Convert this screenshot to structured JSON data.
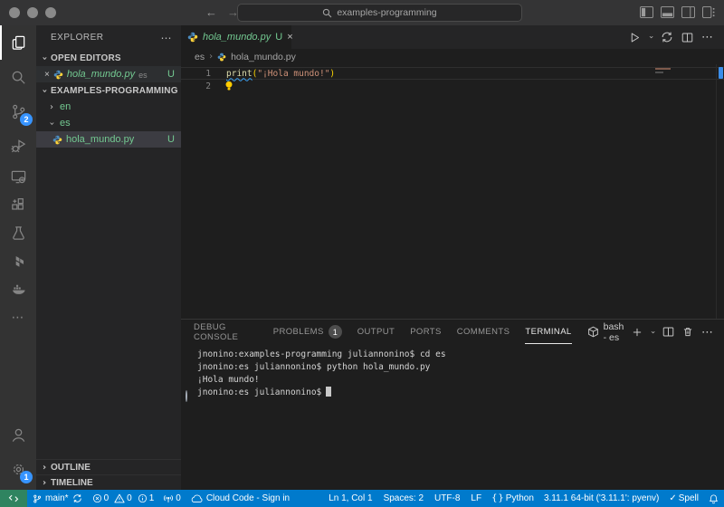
{
  "titlebar": {
    "search_text": "examples-programming"
  },
  "activity_bar": {
    "scm_badge": "2",
    "settings_badge": "1"
  },
  "sidebar": {
    "title": "EXPLORER",
    "open_editors_label": "OPEN EDITORS",
    "open_editor": {
      "file": "hola_mundo.py",
      "path": "es",
      "git": "U"
    },
    "workspace_label": "EXAMPLES-PROGRAMMING",
    "tree": [
      {
        "label": "en"
      },
      {
        "label": "es"
      },
      {
        "label": "hola_mundo.py",
        "git": "U"
      }
    ],
    "outline_label": "OUTLINE",
    "timeline_label": "TIMELINE"
  },
  "editor": {
    "tab": {
      "file": "hola_mundo.py",
      "git": "U"
    },
    "breadcrumb": {
      "folder": "es",
      "file": "hola_mundo.py"
    },
    "code": {
      "line1_num": "1",
      "line2_num": "2",
      "fn": "print",
      "paren_open": "(",
      "string": "\"¡Hola mundo!\"",
      "paren_close": ")"
    }
  },
  "panel": {
    "tabs": [
      {
        "label": "DEBUG CONSOLE"
      },
      {
        "label": "PROBLEMS",
        "badge": "1"
      },
      {
        "label": "OUTPUT"
      },
      {
        "label": "PORTS"
      },
      {
        "label": "COMMENTS"
      },
      {
        "label": "TERMINAL"
      }
    ],
    "shell_label": "bash - es",
    "terminal_lines": [
      {
        "text": "jnonino:examples-programming juliannonino$ cd es"
      },
      {
        "text": "jnonino:es juliannonino$ python hola_mundo.py"
      },
      {
        "text": "¡Hola mundo!"
      },
      {
        "text": "jnonino:es juliannonino$"
      }
    ]
  },
  "status_bar": {
    "branch": "main*",
    "errors": "0",
    "warnings": "0",
    "infos": "1",
    "ports": "0",
    "cloud": "Cloud Code - Sign in",
    "cursor": "Ln 1, Col 1",
    "indent": "Spaces: 2",
    "encoding": "UTF-8",
    "eol": "LF",
    "language": "Python",
    "interpreter": "3.11.1 64-bit ('3.11.1': pyenv)",
    "spell": "Spell"
  },
  "colors": {
    "status_accent": "#007ACC",
    "remote_green": "#2F8460",
    "git_untracked_green": "#73C991",
    "badge_blue": "#3794FF",
    "string_orange": "#CE9178",
    "function_yellow": "#DCDCAA",
    "bracket_gold": "#FFD700",
    "terminal_decoration_blue": "#3B8EEA"
  }
}
